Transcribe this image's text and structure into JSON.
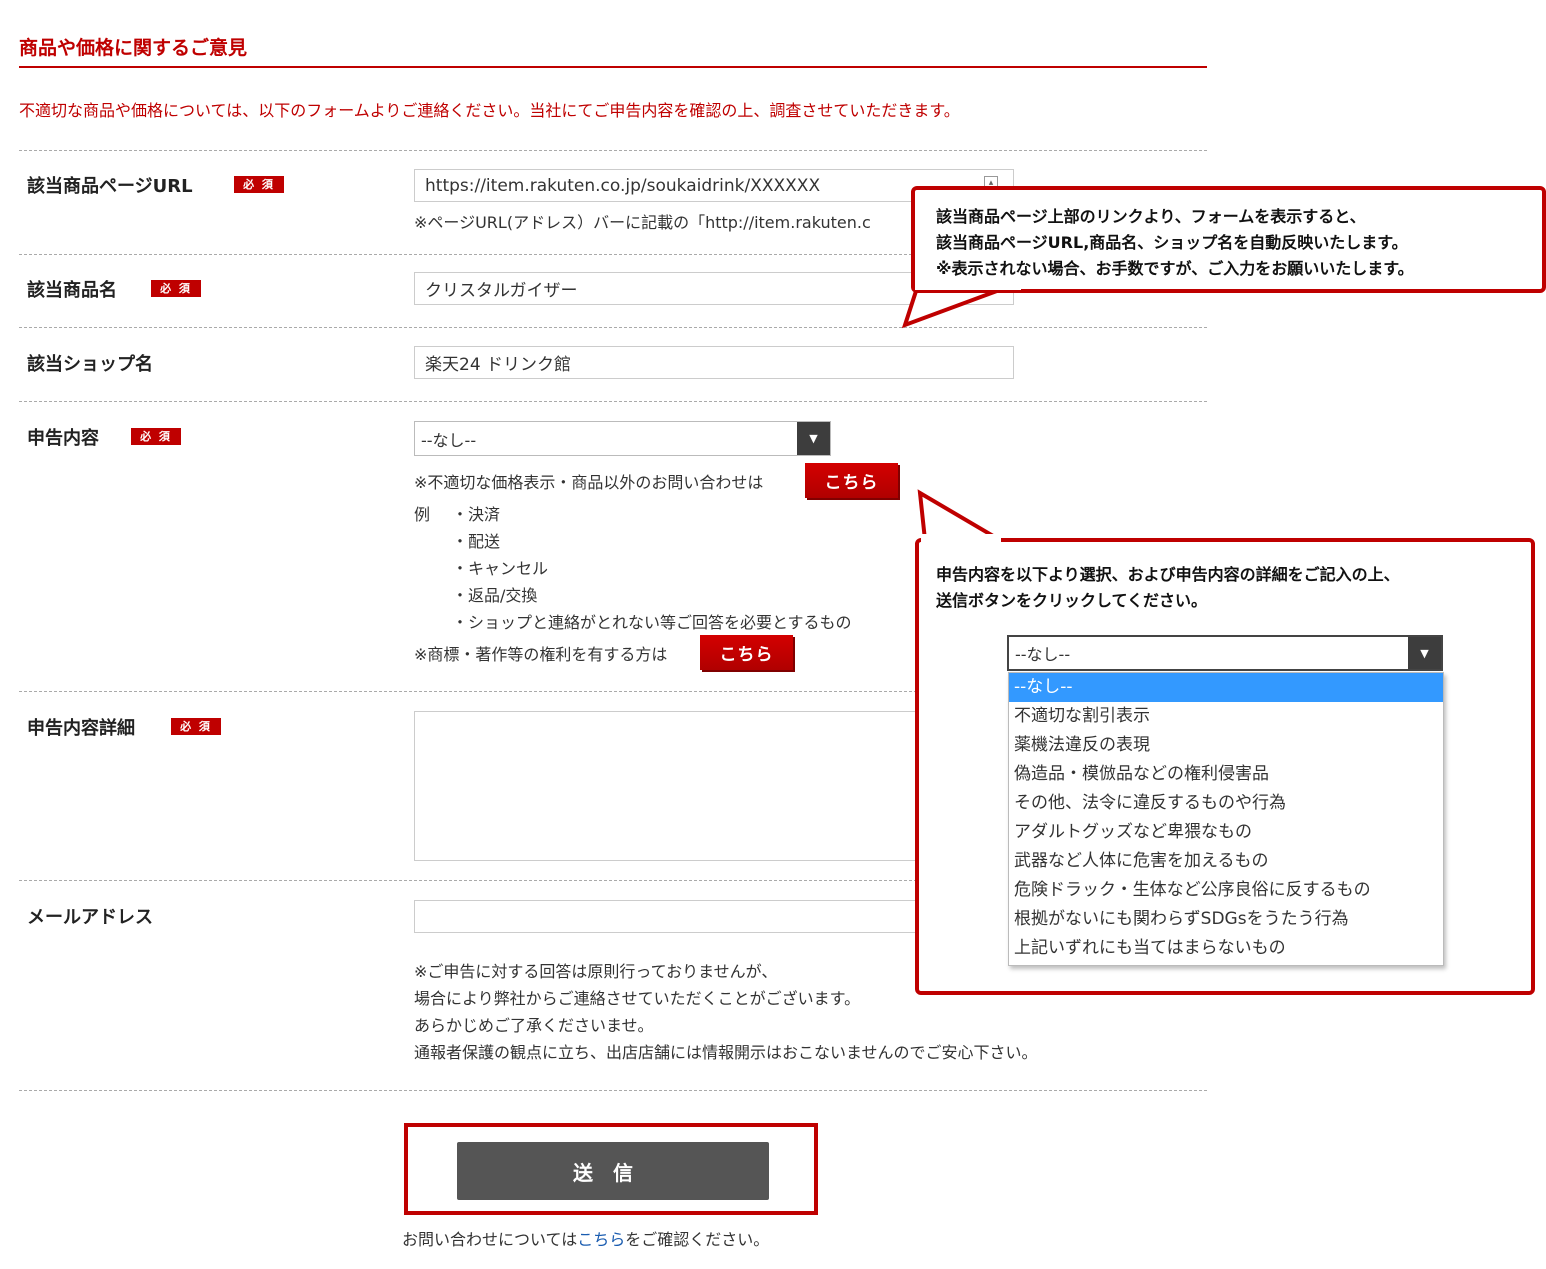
{
  "page": {
    "title": "商品や価格に関するご意見",
    "intro": "不適切な商品や価格については、以下のフォームよりご連絡ください。当社にてご申告内容を確認の上、調査させていただきます。"
  },
  "required_badge": "必 須",
  "form": {
    "url": {
      "label": "該当商品ページURL",
      "value": "https://item.rakuten.co.jp/soukaidrink/XXXXXX",
      "note": "※ページURL(アドレス）バーに記載の「http://item.rakuten.c"
    },
    "product_name": {
      "label": "該当商品名",
      "value": "クリスタルガイザー"
    },
    "shop_name": {
      "label": "該当ショップ名",
      "value": "楽天24 ドリンク館"
    },
    "report_type": {
      "label": "申告内容",
      "selected": "--なし--",
      "other_inquiry_note": "※不適切な価格表示・商品以外のお問い合わせは",
      "kochira_label": "こちら",
      "example_label": "例",
      "examples": [
        "・決済",
        "・配送",
        "・キャンセル",
        "・返品/交換",
        "・ショップと連絡がとれない等ご回答を必要とするもの"
      ],
      "rights_note": "※商標・著作等の権利を有する方は"
    },
    "report_detail": {
      "label": "申告内容詳細",
      "value": ""
    },
    "email": {
      "label": "メールアドレス",
      "value": "",
      "notes": [
        "※ご申告に対する回答は原則行っておりませんが、",
        "場合により弊社からご連絡させていただくことがございます。",
        "あらかじめご了承くださいませ。",
        "通報者保護の観点に立ち、出店店舗には情報開示はおこないませんのでご安心下さい。"
      ]
    },
    "submit_label": "送信",
    "footer": {
      "prefix": "お問い合わせについては",
      "link": "こちら",
      "suffix": "をご確認ください。"
    }
  },
  "callout_top": {
    "lines": [
      "該当商品ページ上部のリンクより、フォームを表示すると、",
      "該当商品ページURL,商品名、ショップ名を自動反映いたします。",
      "※表示されない場合、お手数ですが、ご入力をお願いいたします。"
    ]
  },
  "callout_bottom": {
    "lines": [
      "申告内容を以下より選択、および申告内容の詳細をご記入の上、",
      "送信ボタンをクリックしてください。"
    ],
    "select_value": "--なし--",
    "options": [
      "--なし--",
      "不適切な割引表示",
      "薬機法違反の表現",
      "偽造品・模倣品などの権利侵害品",
      "その他、法令に違反するものや行為",
      "アダルトグッズなど卑猥なもの",
      "武器など人体に危害を加えるもの",
      "危険ドラック・生体など公序良俗に反するもの",
      "根拠がないにも関わらずSDGsをうたう行為",
      "上記いずれにも当てはまらないもの"
    ]
  },
  "colors": {
    "accent": "#bf0000",
    "submit": "#555555",
    "selected_option": "#3399ff",
    "link": "#1a5cb0"
  }
}
